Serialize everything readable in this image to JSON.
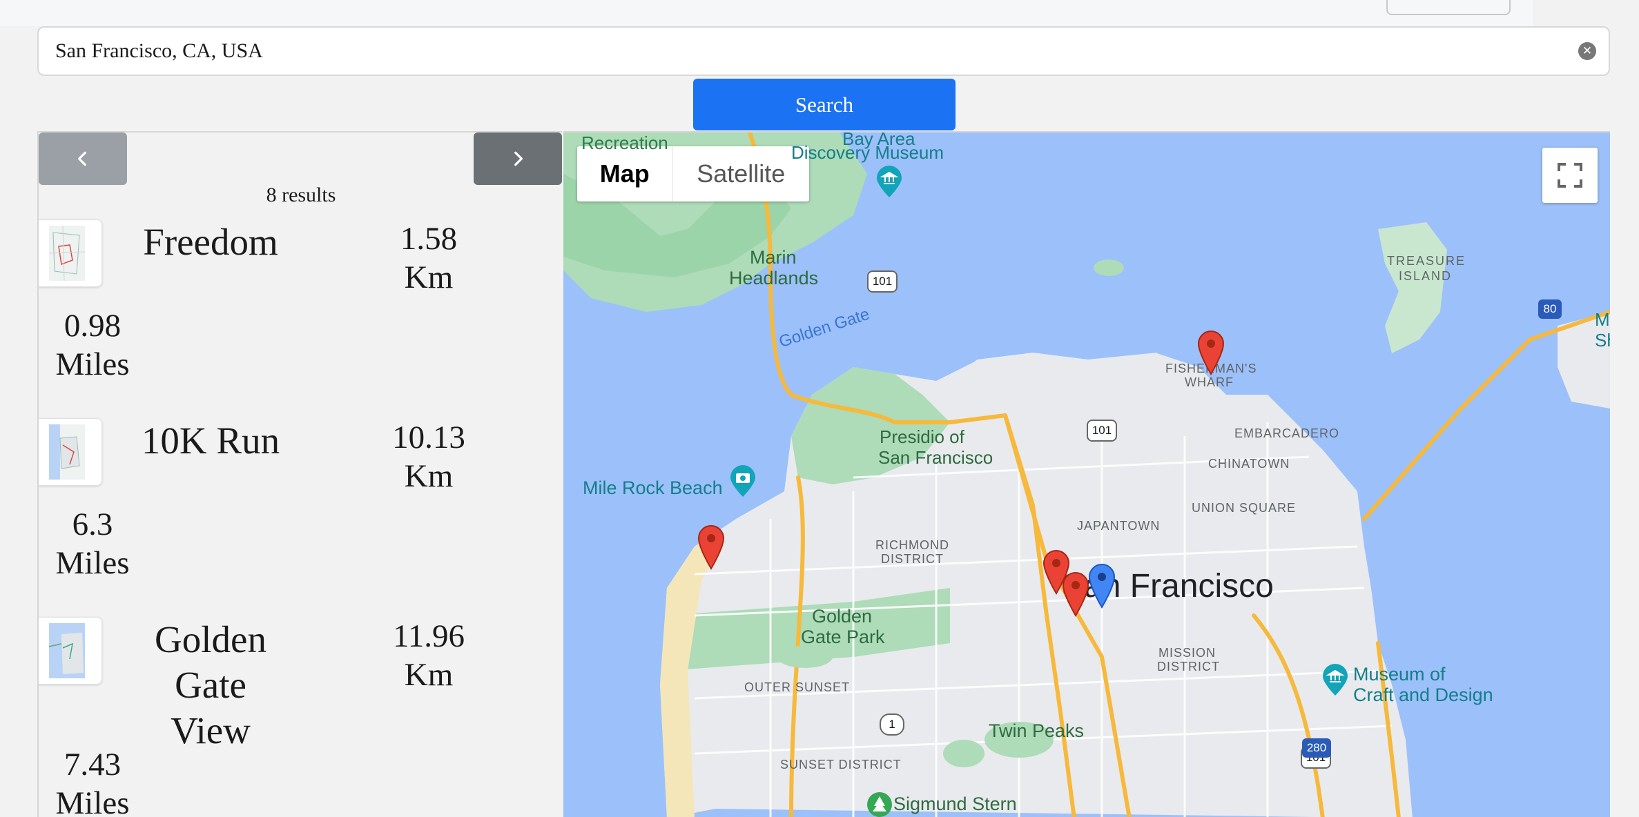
{
  "search": {
    "value": "San Francisco, CA, USA",
    "clear_icon": "close-circle-icon",
    "button_label": "Search"
  },
  "results": {
    "count_label": "8 results",
    "prev_icon": "chevron-left-icon",
    "next_icon": "chevron-right-icon",
    "routes": [
      {
        "name": "Freedom",
        "km": "1.58 Km",
        "miles": "0.98 Miles"
      },
      {
        "name": "10K Run",
        "km": "10.13 Km",
        "miles": "6.3 Miles"
      },
      {
        "name": "Golden Gate View",
        "km": "11.96 Km",
        "miles": "7.43 Miles"
      }
    ]
  },
  "map": {
    "type_buttons": {
      "map": "Map",
      "satellite": "Satellite"
    },
    "selected_type": "Map",
    "fullscreen_icon": "fullscreen-icon",
    "city_label": "San Francisco",
    "labels": {
      "recreation": "Recreation",
      "museum_bay": "Bay Area",
      "museum_discovery": "Discovery Museum",
      "marin": "Marin",
      "headlands": "Headlands",
      "golden_gate": "Golden Gate",
      "treasure": "TREASURE",
      "island": "ISLAND",
      "fishermans": "FISHERMAN'S",
      "wharf": "WHARF",
      "presidio1": "Presidio of",
      "presidio2": "San Francisco",
      "embarcadero": "EMBARCADERO",
      "chinatown": "CHINATOWN",
      "mile_rock": "Mile Rock Beach",
      "japantown": "JAPANTOWN",
      "union_square": "UNION SQUARE",
      "richmond1": "RICHMOND",
      "richmond2": "DISTRICT",
      "ggpark1": "Golden",
      "ggpark2": "Gate Park",
      "mission1": "MISSION",
      "mission2": "DISTRICT",
      "outer_sunset": "OUTER SUNSET",
      "museum_craft1": "Museum of",
      "museum_craft2": "Craft and Design",
      "twin_peaks": "Twin Peaks",
      "sunset_district": "SUNSET DISTRICT",
      "sigmund": "Sigmund Stern",
      "edge_m": "M",
      "edge_sh": "Sh"
    },
    "shields": {
      "hw101": "101",
      "hw80": "80",
      "hw1": "1",
      "hw280": "280"
    },
    "colors": {
      "water": "#9cc0f9",
      "land": "#e8eaed",
      "park": "#a8dab5",
      "highway": "#f9c35c",
      "pin_red": "#ea4335",
      "pin_blue": "#4285f4"
    }
  }
}
